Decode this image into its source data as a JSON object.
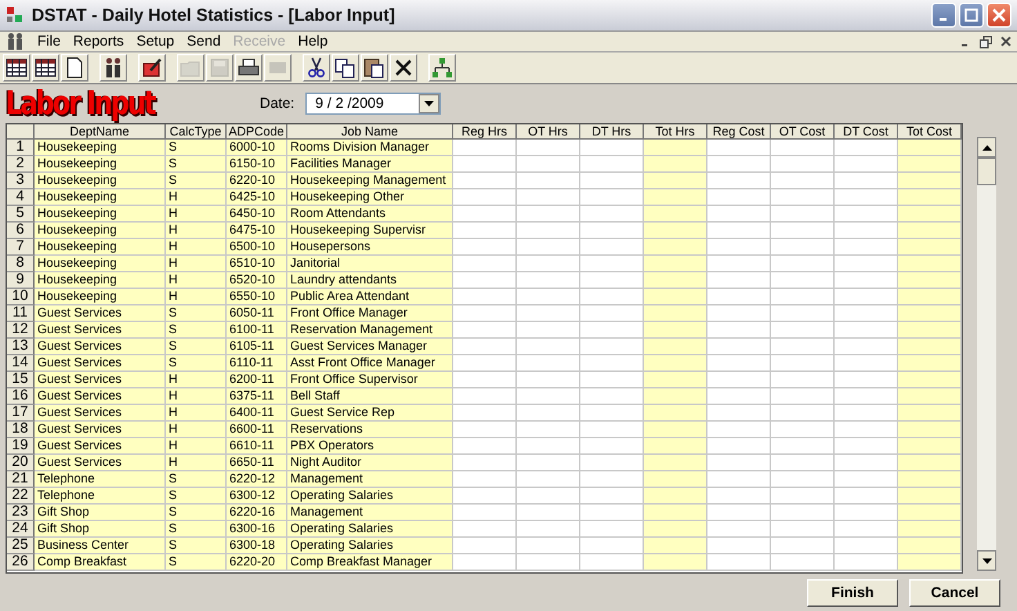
{
  "window": {
    "title": "DSTAT - Daily Hotel Statistics - [Labor Input]"
  },
  "menu": [
    {
      "label": "File",
      "disabled": false
    },
    {
      "label": "Reports",
      "disabled": false
    },
    {
      "label": "Setup",
      "disabled": false
    },
    {
      "label": "Send",
      "disabled": false
    },
    {
      "label": "Receive",
      "disabled": true
    },
    {
      "label": "Help",
      "disabled": false
    }
  ],
  "toolbar": [
    {
      "kind": "grid",
      "disabled": false
    },
    {
      "kind": "grid",
      "disabled": false
    },
    {
      "kind": "page",
      "disabled": false
    },
    {
      "kind": "sep"
    },
    {
      "kind": "people",
      "disabled": false
    },
    {
      "kind": "sep"
    },
    {
      "kind": "edit",
      "disabled": false
    },
    {
      "kind": "sep"
    },
    {
      "kind": "folder",
      "disabled": true
    },
    {
      "kind": "save",
      "disabled": true
    },
    {
      "kind": "print",
      "disabled": false
    },
    {
      "kind": "blank",
      "disabled": true
    },
    {
      "kind": "sep"
    },
    {
      "kind": "cut",
      "disabled": false
    },
    {
      "kind": "copy",
      "disabled": false
    },
    {
      "kind": "paste",
      "disabled": false
    },
    {
      "kind": "delete",
      "disabled": false
    },
    {
      "kind": "sep"
    },
    {
      "kind": "tree",
      "disabled": false
    }
  ],
  "heading": "Labor Input",
  "date": {
    "label": "Date:",
    "value": "9 / 2 /2009"
  },
  "table": {
    "columns": [
      {
        "label": "DeptName",
        "highlight": true
      },
      {
        "label": "CalcType",
        "highlight": true
      },
      {
        "label": "ADPCode",
        "highlight": true
      },
      {
        "label": "Job Name",
        "highlight": true
      },
      {
        "label": "Reg Hrs",
        "highlight": false
      },
      {
        "label": "OT Hrs",
        "highlight": false
      },
      {
        "label": "DT Hrs",
        "highlight": false
      },
      {
        "label": "Tot Hrs",
        "highlight": true
      },
      {
        "label": "Reg Cost",
        "highlight": false
      },
      {
        "label": "OT Cost",
        "highlight": false
      },
      {
        "label": "DT Cost",
        "highlight": false
      },
      {
        "label": "Tot Cost",
        "highlight": true
      }
    ],
    "rows": [
      {
        "n": "1",
        "cells": [
          "Housekeeping",
          "S",
          "6000-10",
          "Rooms Division Manager"
        ]
      },
      {
        "n": "2",
        "cells": [
          "Housekeeping",
          "S",
          "6150-10",
          "Facilities Manager"
        ]
      },
      {
        "n": "3",
        "cells": [
          "Housekeeping",
          "S",
          "6220-10",
          "Housekeeping Management"
        ]
      },
      {
        "n": "4",
        "cells": [
          "Housekeeping",
          "H",
          "6425-10",
          "Housekeeping Other"
        ]
      },
      {
        "n": "5",
        "cells": [
          "Housekeeping",
          "H",
          "6450-10",
          "Room Attendants"
        ]
      },
      {
        "n": "6",
        "cells": [
          "Housekeeping",
          "H",
          "6475-10",
          "Housekeeping Supervisr"
        ]
      },
      {
        "n": "7",
        "cells": [
          "Housekeeping",
          "H",
          "6500-10",
          "Housepersons"
        ]
      },
      {
        "n": "8",
        "cells": [
          "Housekeeping",
          "H",
          "6510-10",
          "Janitorial"
        ]
      },
      {
        "n": "9",
        "cells": [
          "Housekeeping",
          "H",
          "6520-10",
          "Laundry attendants"
        ]
      },
      {
        "n": "10",
        "cells": [
          "Housekeeping",
          "H",
          "6550-10",
          "Public Area Attendant"
        ]
      },
      {
        "n": "11",
        "cells": [
          "Guest Services",
          "S",
          "6050-11",
          "Front Office Manager"
        ]
      },
      {
        "n": "12",
        "cells": [
          "Guest Services",
          "S",
          "6100-11",
          "Reservation Management"
        ]
      },
      {
        "n": "13",
        "cells": [
          "Guest Services",
          "S",
          "6105-11",
          "Guest Services Manager"
        ]
      },
      {
        "n": "14",
        "cells": [
          "Guest Services",
          "S",
          "6110-11",
          "Asst Front Office Manager"
        ]
      },
      {
        "n": "15",
        "cells": [
          "Guest Services",
          "H",
          "6200-11",
          "Front Office Supervisor"
        ]
      },
      {
        "n": "16",
        "cells": [
          "Guest Services",
          "H",
          "6375-11",
          "Bell Staff"
        ]
      },
      {
        "n": "17",
        "cells": [
          "Guest Services",
          "H",
          "6400-11",
          "Guest Service Rep"
        ]
      },
      {
        "n": "18",
        "cells": [
          "Guest Services",
          "H",
          "6600-11",
          "Reservations"
        ]
      },
      {
        "n": "19",
        "cells": [
          "Guest Services",
          "H",
          "6610-11",
          "PBX Operators"
        ]
      },
      {
        "n": "20",
        "cells": [
          "Guest Services",
          "H",
          "6650-11",
          "Night Auditor"
        ]
      },
      {
        "n": "21",
        "cells": [
          "Telephone",
          "S",
          "6220-12",
          "Management"
        ]
      },
      {
        "n": "22",
        "cells": [
          "Telephone",
          "S",
          "6300-12",
          "Operating Salaries"
        ]
      },
      {
        "n": "23",
        "cells": [
          "Gift Shop",
          "S",
          "6220-16",
          "Management"
        ]
      },
      {
        "n": "24",
        "cells": [
          "Gift Shop",
          "S",
          "6300-16",
          "Operating Salaries"
        ]
      },
      {
        "n": "25",
        "cells": [
          "Business Center",
          "S",
          "6300-18",
          "Operating Salaries"
        ]
      },
      {
        "n": "26",
        "cells": [
          "Comp Breakfast",
          "S",
          "6220-20",
          "Comp Breakfast Manager"
        ]
      }
    ]
  },
  "buttons": [
    {
      "label": "Finish"
    },
    {
      "label": "Cancel"
    }
  ]
}
